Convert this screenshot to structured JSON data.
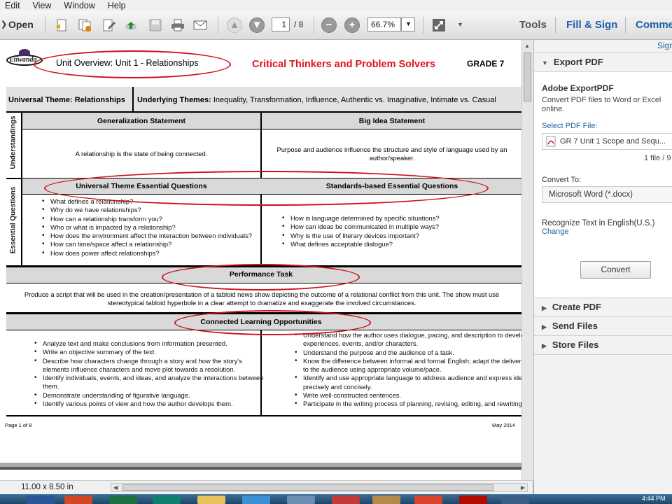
{
  "menu": [
    "Edit",
    "View",
    "Window",
    "Help"
  ],
  "toolbar": {
    "open_label": "Open",
    "page_current": "1",
    "page_total": "/ 8",
    "zoom": "66.7%",
    "tools_label": "Tools",
    "fill_sign_label": "Fill & Sign",
    "comment_label": "Comme"
  },
  "document": {
    "logo_text": "Etiwanda",
    "unit_overview": "Unit Overview: Unit 1 - Relationships",
    "program_title": "Critical Thinkers and Problem Solvers",
    "grade": "GRADE 7",
    "universal_theme": "Universal Theme: Relationships",
    "underlying_label": "Underlying Themes:",
    "underlying_values": "Inequality, Transformation, Influence, Authentic vs. Imaginative, Intimate vs. Casual",
    "understandings_side": "Understandings",
    "essential_side": "Essential Questions",
    "generalization_head": "Generalization Statement",
    "big_idea_head": "Big Idea Statement",
    "generalization_text": "A relationship is the state of being connected.",
    "big_idea_text": "Purpose and audience influence the structure and style of language used by an author/speaker.",
    "ute_head": "Universal Theme Essential Questions",
    "sbe_head": "Standards-based Essential Questions",
    "ute_questions": [
      "What defines a relationship?",
      "Why do we have relationships?",
      "How can a relationship transform you?",
      "Who or what is impacted by a relationship?",
      "How does the environment affect the interaction between individuals?",
      "How can time/space affect a relationship?",
      "How does power affect relationships?"
    ],
    "sbe_questions": [
      "How is language determined by specific situations?",
      "How can ideas be communicated in multiple ways?",
      "Why is the use of literary devices important?",
      "What defines acceptable dialogue?"
    ],
    "performance_head": "Performance Task",
    "performance_text": "Produce a script that will be used in the creation/presentation of a tabloid news show depicting the outcome of a relational conflict from this unit.  The show must use stereotypical tabloid hyperbole in a clear attempt to dramatize and exaggerate the involved circumstances.",
    "clo_head": "Connected Learning Opportunities",
    "clo_left": [
      "Analyze text and make conclusions from information presented.",
      "Write an objective summary of the text.",
      "Describe how characters change through a story and how the story's elements influence characters and move plot towards a resolution.",
      "Identify individuals, events, and ideas, and analyze the interactions between them.",
      "Demonstrate understanding of figurative language.",
      "Identify various points of view and how the author develops them."
    ],
    "clo_right": [
      "Understand how the author uses dialogue, pacing, and description to develop experiences, events, and/or characters.",
      "Understand the purpose and the audience of a task.",
      "Know the difference between informal and formal English; adapt the delivery to the audience using appropriate volume/pace.",
      "Identify and use appropriate language to address audience and express ideas precisely and concisely.",
      "Write well-constructed sentences.",
      "Participate in the writing process of planning, revising, editing, and rewriting."
    ],
    "footer_left": "Page 1 of 8",
    "footer_right": "May 2014"
  },
  "status": {
    "page_size": "11.00 x 8.50 in"
  },
  "pane": {
    "sign_link": "Sign",
    "export_header": "Export PDF",
    "adobe_export_title": "Adobe ExportPDF",
    "adobe_export_desc": "Convert PDF files to Word or Excel online.",
    "select_label": "Select PDF File:",
    "file_name": "GR 7 Unit 1 Scope and Sequ...",
    "file_count": "1 file / 9",
    "convert_to_label": "Convert To:",
    "convert_option": "Microsoft Word (*.docx)",
    "recognize_text": "Recognize Text in English(U.S.)",
    "change_link": "Change",
    "convert_button": "Convert",
    "create_header": "Create PDF",
    "send_header": "Send Files",
    "store_header": "Store Files"
  },
  "taskbar": {
    "clock": "4:44 PM"
  },
  "colors": {
    "accent_blue": "#1b5fa8",
    "annotation_red": "#d0111b",
    "title_red": "#e0121c"
  }
}
